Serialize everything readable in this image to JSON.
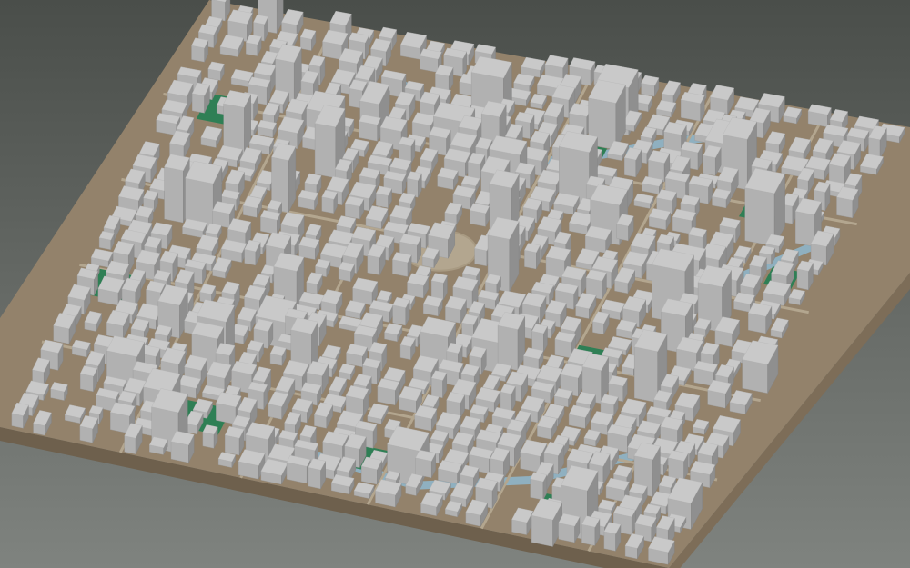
{
  "scene": {
    "kind": "3d-city-block-model",
    "view": "isometric-oblique",
    "colors": {
      "background_top": "#4a4e4a",
      "background_bottom": "#7f837f",
      "ground": "#93826b",
      "base_side": "#7d6d58",
      "base_front": "#6e604d",
      "building_roof": "#c9c9c9",
      "building_side_light": "#b1b1b1",
      "building_side_dark": "#8f8f8f",
      "park": "#2f7f55",
      "water": "#8fb0c0",
      "road": "#b3a68f"
    },
    "layers": [
      "ground",
      "water",
      "roads",
      "parks",
      "buildings"
    ]
  }
}
